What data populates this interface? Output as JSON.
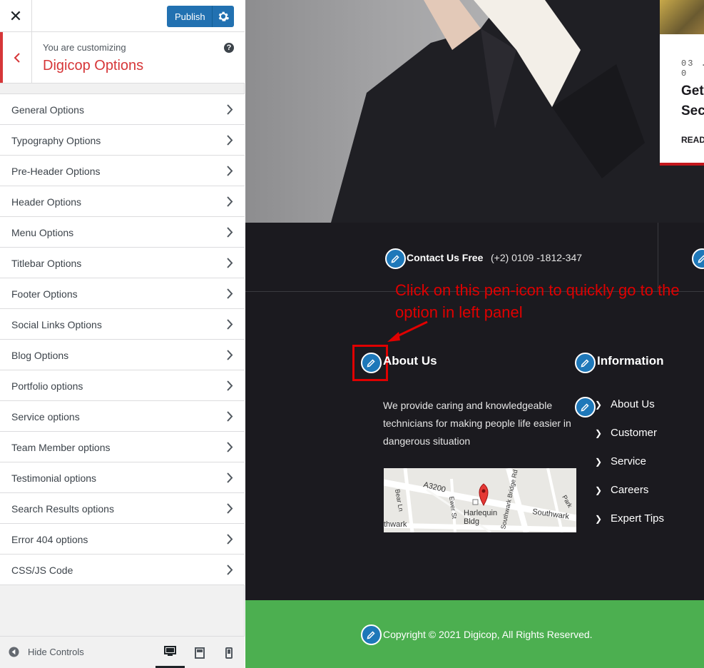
{
  "topbar": {
    "close_icon": "close-icon",
    "publish_label": "Publish"
  },
  "info": {
    "customizing": "You are customizing",
    "section_title": "Digicop Options"
  },
  "menu": {
    "items": [
      {
        "label": "General Options"
      },
      {
        "label": "Typography Options"
      },
      {
        "label": "Pre-Header Options"
      },
      {
        "label": "Header Options"
      },
      {
        "label": "Menu Options"
      },
      {
        "label": "Titlebar Options"
      },
      {
        "label": "Footer Options"
      },
      {
        "label": "Social Links Options"
      },
      {
        "label": "Blog Options"
      },
      {
        "label": "Portfolio options"
      },
      {
        "label": "Service options"
      },
      {
        "label": "Team Member options"
      },
      {
        "label": "Testimonial options"
      },
      {
        "label": "Search Results options"
      },
      {
        "label": "Error 404 options"
      },
      {
        "label": "CSS/JS Code"
      }
    ]
  },
  "footer": {
    "hide_controls": "Hide Controls"
  },
  "preview": {
    "card": {
      "date": "03 . 0",
      "title_line1": "Get",
      "title_line2": "Secu",
      "read_more": "READ"
    },
    "contact": {
      "label": "Contact Us Free",
      "phone": "(+2) 0109 -1812-347"
    },
    "annotation": "Click on this pen-icon to quickly go to the option in left panel",
    "about": {
      "heading": "About Us",
      "text": "We provide caring and knowledgeable technicians for making people life easier in dangerous situation"
    },
    "map": {
      "labels": [
        "A3200",
        "Bear Ln",
        "Ewer St",
        "Harlequin",
        "Bldg",
        "Southwark Bridge Rd",
        "Southwark",
        "thwark",
        "Park"
      ]
    },
    "information": {
      "heading": "Information",
      "links": [
        "About Us",
        "Customer",
        "Service",
        "Careers",
        "Expert Tips"
      ]
    },
    "copyright": "Copyright © 2021 Digicop, All Rights Reserved."
  },
  "colors": {
    "accent": "#d63638",
    "publish": "#2271b1",
    "pen": "#1e78b9",
    "footer_bg": "#1b1a1f",
    "copy_bg": "#4caf50",
    "annotation": "#e00000"
  }
}
